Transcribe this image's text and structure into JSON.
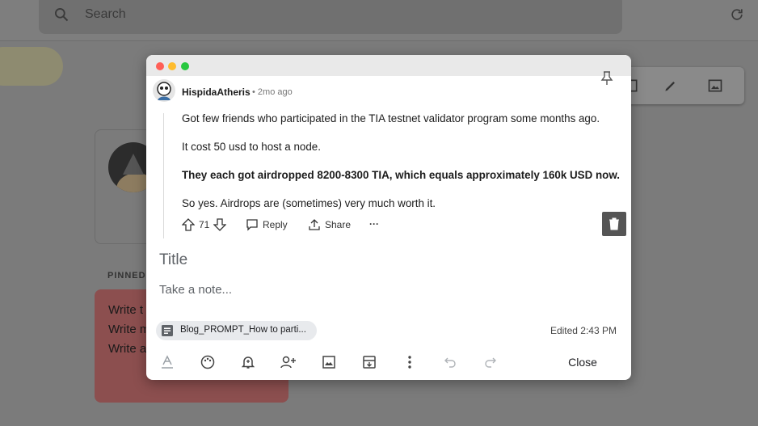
{
  "app": {
    "search": {
      "placeholder": "Search"
    },
    "pinned_label": "PINNED",
    "pinned_note_lines": [
      "Write t",
      "Write m",
      "Write a"
    ]
  },
  "modal": {
    "post": {
      "username": "HispidaAtheris",
      "age": "• 2mo ago",
      "paragraphs": [
        "Got few friends who participated in the TIA testnet validator program some months ago.",
        "It cost 50 usd to host a node.",
        "They each got airdropped 8200-8300 TIA, which equals approximately 160k USD now.",
        "So yes. Airdrops are (sometimes) very much worth it."
      ],
      "vote_count": "71",
      "reply_label": "Reply",
      "share_label": "Share",
      "more_label": "···"
    },
    "title_placeholder": "Title",
    "note_placeholder": "Take a note...",
    "attachment_name": "Blog_PROMPT_How to parti...",
    "edited": "Edited 2:43 PM",
    "close_label": "Close",
    "colors": {
      "window_red": "#ff5f57",
      "window_yellow": "#febc2e",
      "window_green": "#28c840",
      "trash_bg": "#555555"
    },
    "bottom_icons": [
      "text-format-icon",
      "palette-icon",
      "bell-icon",
      "add-collaborator-icon",
      "image-icon",
      "archive-icon",
      "more-vert-icon",
      "undo-icon",
      "redo-icon"
    ]
  }
}
